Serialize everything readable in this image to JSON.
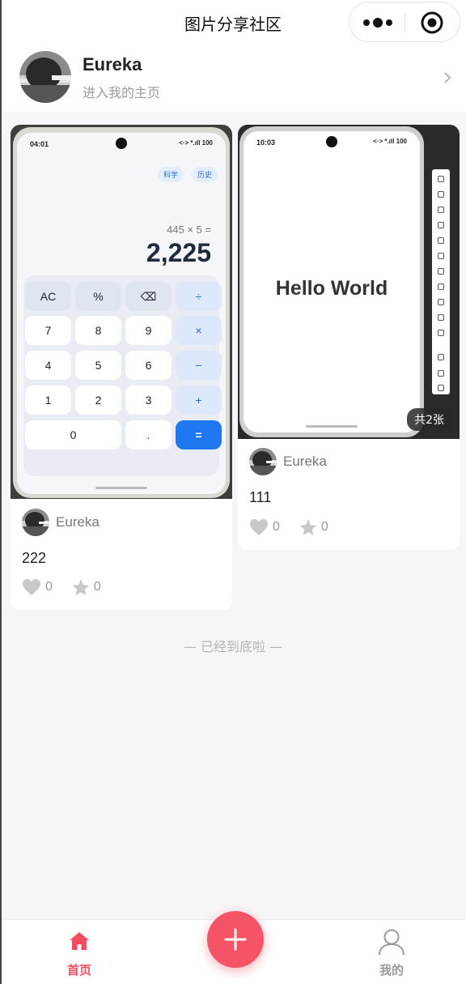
{
  "navbar": {
    "title": "图片分享社区"
  },
  "profile": {
    "name": "Eureka",
    "subtitle": "进入我的主页"
  },
  "posts": [
    {
      "author": "Eureka",
      "title": "222",
      "likes": "0",
      "stars": "0",
      "image": {
        "kind": "calculator-screenshot",
        "time": "04:01",
        "status_right": "<·> *.ıll 100",
        "pills": [
          "科学",
          "历史"
        ],
        "expression": "445 × 5 =",
        "result": "2,225",
        "keys": [
          [
            "AC",
            "%",
            "⌫",
            "÷"
          ],
          [
            "7",
            "8",
            "9",
            "×"
          ],
          [
            "4",
            "5",
            "6",
            "−"
          ],
          [
            "1",
            "2",
            "3",
            "+"
          ],
          [
            "0",
            ".",
            "="
          ]
        ]
      }
    },
    {
      "author": "Eureka",
      "title": "111",
      "likes": "0",
      "stars": "0",
      "image_count_badge": "共2张",
      "image": {
        "kind": "hello-world-screenshot",
        "time": "10:03",
        "status_right": "<·> *.ıll 100",
        "text": "Hello World"
      }
    }
  ],
  "end_note": "— 已经到底啦 —",
  "tabbar": {
    "home_label": "首页",
    "mine_label": "我的"
  },
  "colors": {
    "accent": "#f45466",
    "background": "#f6f6f8"
  },
  "icons": [
    "more-icon",
    "target-icon",
    "chevron-right-icon",
    "heart-icon",
    "star-icon",
    "home-icon",
    "plus-icon",
    "user-icon"
  ]
}
